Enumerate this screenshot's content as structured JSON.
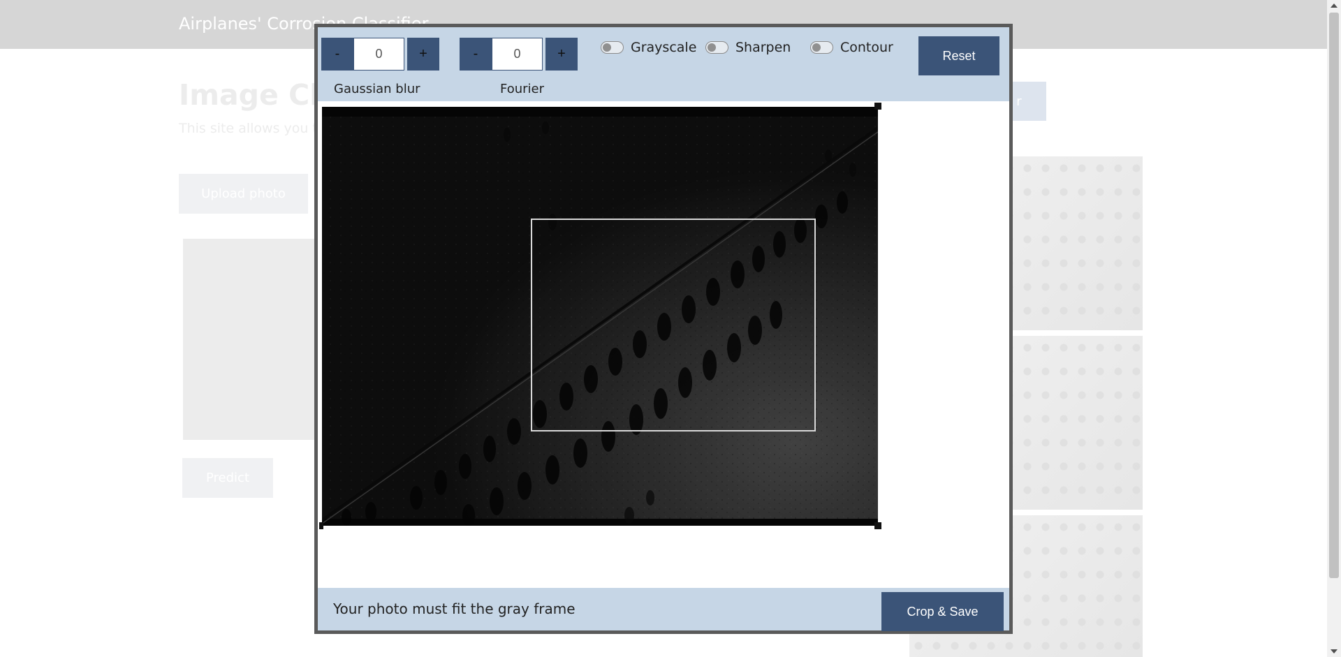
{
  "background": {
    "brand": "Airplanes' Corrosion Classifier",
    "page_title": "Image Clas",
    "page_desc": "This site allows you to",
    "upload_label": "Upload photo",
    "predict_label": "Predict",
    "right_button_label": "r"
  },
  "modal": {
    "gaussian": {
      "minus": "-",
      "value": "0",
      "plus": "+",
      "label": "Gaussian blur"
    },
    "fourier": {
      "minus": "-",
      "value": "0",
      "plus": "+",
      "label": "Fourier"
    },
    "toggles": [
      {
        "label": "Grayscale",
        "checked": false
      },
      {
        "label": "Sharpen",
        "checked": false
      },
      {
        "label": "Contour",
        "checked": false
      }
    ],
    "reset_label": "Reset",
    "footer_hint": "Your photo must fit the gray frame",
    "crop_save_label": "Crop & Save"
  },
  "colors": {
    "accent": "#3b5478",
    "panel": "#c6d6e6",
    "modal_border": "#5a5a5a",
    "topbar": "#d6d6d6"
  }
}
